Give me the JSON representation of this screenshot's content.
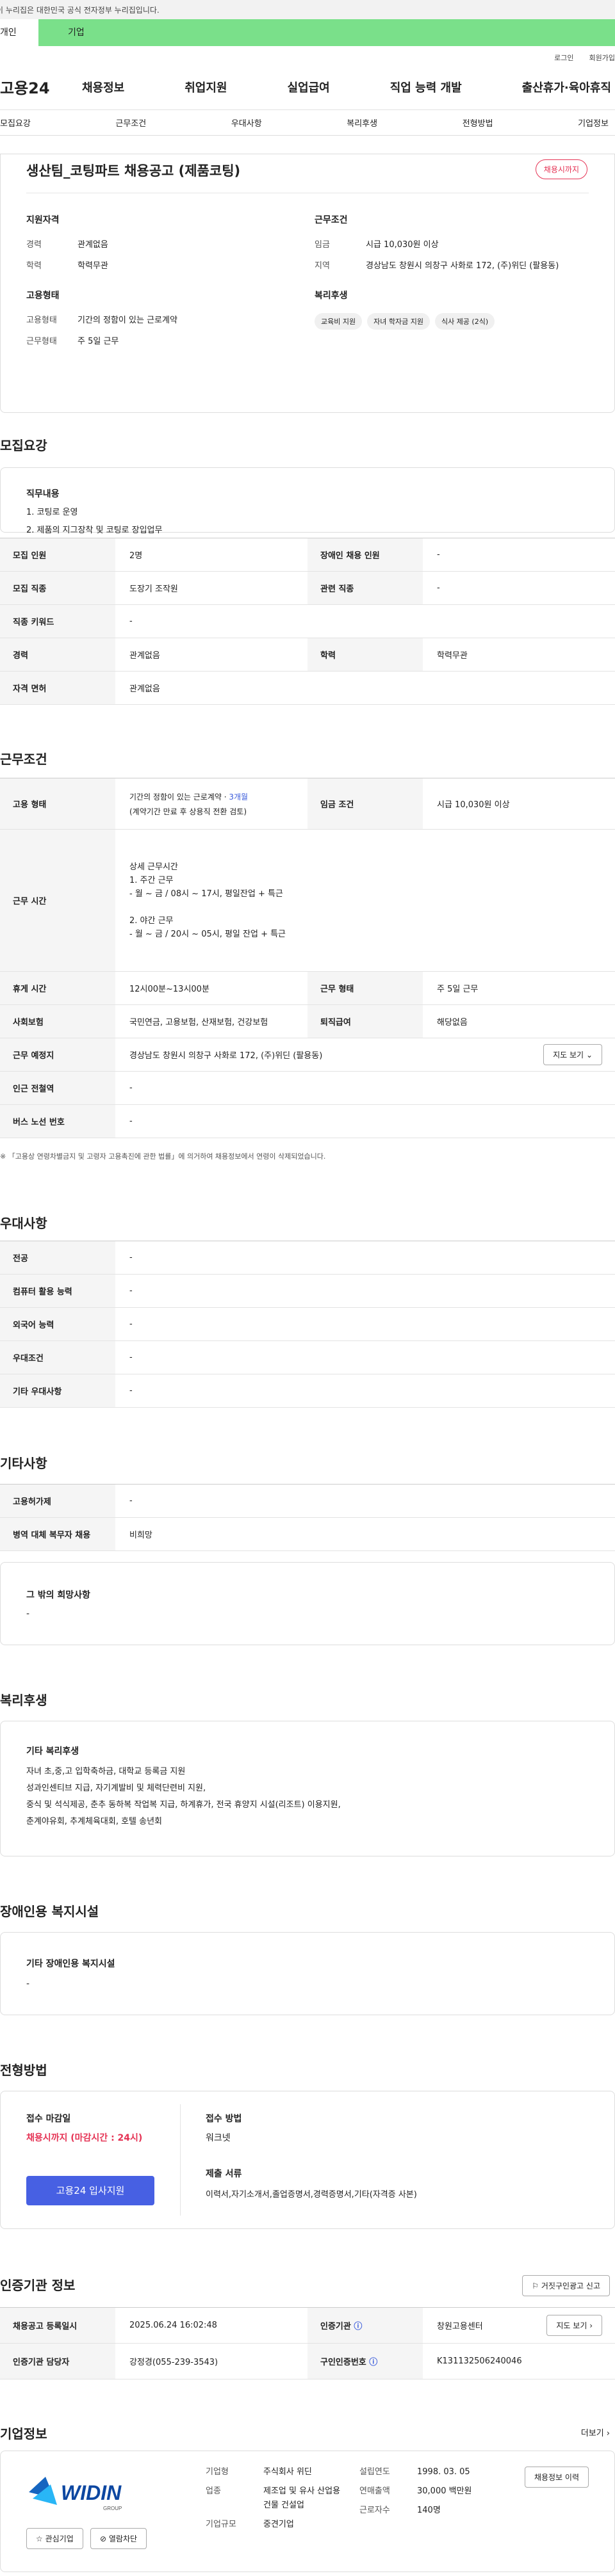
{
  "gov_banner": "이 누리집은 대한민국 공식 전자정부 누리집입니다.",
  "top_tabs": [
    "개인",
    "기업"
  ],
  "util": [
    "로그인",
    "회원가입"
  ],
  "logo": "고용24",
  "gnb": [
    "채용정보",
    "취업지원",
    "실업급여",
    "직업 능력 개발",
    "출산휴가·육아휴직"
  ],
  "subnav": [
    "모집요강",
    "근무조건",
    "우대사항",
    "복리후생",
    "전형방법",
    "기업정보"
  ],
  "summary": {
    "title": "생산팀_코팅파트 채용공고 (제품코팅)",
    "status": "채용시까지",
    "qual_h": "지원자격",
    "career_k": "경력",
    "career_v": "관계없음",
    "edu_k": "학력",
    "edu_v": "학력무관",
    "cond_h": "근무조건",
    "wage_k": "임금",
    "wage_v": "시급 10,030원 이상",
    "area_k": "지역",
    "area_v": "경상남도 창원시 의창구 사화로 172, (주)위딘 (팔용동)",
    "emp_h": "고용형태",
    "emptype_k": "고용형태",
    "emptype_v": "기간의 정함이 있는 근로계약",
    "workdays_k": "근무형태",
    "workdays_v": "주 5일 근무",
    "welfare_h": "복리후생",
    "welfare_chips": [
      "교육비 지원",
      "자녀 학자금 지원",
      "식사 제공 (2식)"
    ]
  },
  "recruit": {
    "heading": "모집요강",
    "duty_h": "직무내용",
    "duties": [
      "1. 코팅로 운영",
      "2. 제품의 지그장착 및 코팅로 장입업무"
    ],
    "rows": [
      {
        "k1": "모집 인원",
        "v1": "2명",
        "k2": "장애인 채용 인원",
        "v2": "-"
      },
      {
        "k1": "모집 직종",
        "v1": "도장기 조작원",
        "k2": "관련 직종",
        "v2": "-"
      },
      {
        "k1": "직종 키워드",
        "v1": "-"
      },
      {
        "k1": "경력",
        "v1": "관계없음",
        "k2": "학력",
        "v2": "학력무관"
      },
      {
        "k1": "자격 면허",
        "v1": "관계없음"
      }
    ]
  },
  "work": {
    "heading": "근무조건",
    "emp_k": "고용 형태",
    "emp_v1": "기간의 정함이 있는 근로계약 · ",
    "emp_v1b": "3개월",
    "emp_v2": "(계약기간 만료 후 상용직 전환 검토)",
    "wage_k": "임금 조건",
    "wage_v": "시급 10,030원 이상",
    "hours_k": "근무 시간",
    "hours_lines": [
      "상세 근무시간",
      "1. 주간 근무",
      " - 월 ~ 금 / 08시 ~ 17시, 평일잔업 + 특근",
      "",
      "2. 야간 근무",
      " - 월 ~ 금 / 20시 ~ 05시, 평일 잔업 + 특근"
    ],
    "rest_k": "휴게 시간",
    "rest_v": "12시00분~13시00분",
    "type_k": "근무 형태",
    "type_v": "주 5일 근무",
    "ins_k": "사회보험",
    "ins_v": "국민연금, 고용보험, 산재보험, 건강보험",
    "sev_k": "퇴직급여",
    "sev_v": "해당없음",
    "place_k": "근무 예정지",
    "place_v": "경상남도 창원시 의창구 사화로 172, (주)위딘 (팔용동)",
    "map_btn": "지도 보기",
    "subway_k": "인근 전철역",
    "subway_v": "-",
    "bus_k": "버스 노선 번호",
    "bus_v": "-",
    "note": "「고용상 연령차별금지 및 고령자 고용촉진에 관한 법률」에 의거하여 채용정보에서 연령이 삭제되었습니다."
  },
  "pref": {
    "heading": "우대사항",
    "rows": [
      [
        "전공",
        "-"
      ],
      [
        "컴퓨터 활용 능력",
        "-"
      ],
      [
        "외국어 능력",
        "-"
      ],
      [
        "우대조건",
        "-"
      ],
      [
        "기타 우대사항",
        "-"
      ]
    ]
  },
  "etc": {
    "heading": "기타사항",
    "rows": [
      [
        "고용허가제",
        "-"
      ],
      [
        "병역 대체 복무자 채용",
        "비희망"
      ]
    ],
    "wish_h": "그 밖의 희망사항",
    "wish_v": "-"
  },
  "welfare": {
    "heading": "복리후생",
    "box_h": "기타 복리후생",
    "lines": [
      "자녀 초,중,고 입학축하금, 대학교 등록금 지원",
      "성과인센티브 지급, 자기계발비 및 체력단련비 지원,",
      "중식 및 석식제공, 춘추 동하복 작업복 지급, 하계휴가, 전국 휴양지 시설(리조트) 이용지원,",
      "춘계야유회, 추계체육대회, 호텔 송년회"
    ]
  },
  "disab": {
    "heading": "장애인용 복지시설",
    "box_h": "기타 장애인용 복지시설",
    "value": "-"
  },
  "process": {
    "heading": "전형방법",
    "deadline_h": "접수 마감일",
    "deadline_v": "채용시까지 (마감시간 : 24시)",
    "apply_btn": "고용24 입사지원",
    "method_h": "접수 방법",
    "method_v": "워크넷",
    "docs_h": "제출 서류",
    "docs_v": "이력서,자기소개서,졸업증명서,경력증명서,기타(자격증 사본)"
  },
  "cert": {
    "heading": "인증기관 정보",
    "report_btn": "거짓구인광고 신고",
    "reg_k": "채용공고 등록일시",
    "reg_v": "2025.06.24 16:02:48",
    "org_k": "인증기관",
    "org_v": "창원고용센터",
    "staff_k": "인증기관 담당자",
    "staff_v": "강정경(055-239-3543)",
    "id_k": "구인인증번호",
    "id_v": "K131132506240046",
    "map_btn": "지도 보기"
  },
  "company": {
    "heading": "기업정보",
    "more": "더보기 ›",
    "logo_text": "WIDIN",
    "logo_sub": "GROUP",
    "fav_btn": "관심기업",
    "block_btn": "열람차단",
    "k_type": "기업형",
    "v_type": "주식회사 위딘",
    "k_industry": "업종",
    "v_industry": "제조업 및 유사 산업용 건물 건설업",
    "k_size": "기업규모",
    "v_size": "중견기업",
    "k_year": "설립연도",
    "v_year": "1998. 03. 05",
    "k_sales": "연매출액",
    "v_sales": "30,000 백만원",
    "k_emp": "근로자수",
    "v_emp": "140명",
    "history_btn": "채용정보 이력"
  }
}
